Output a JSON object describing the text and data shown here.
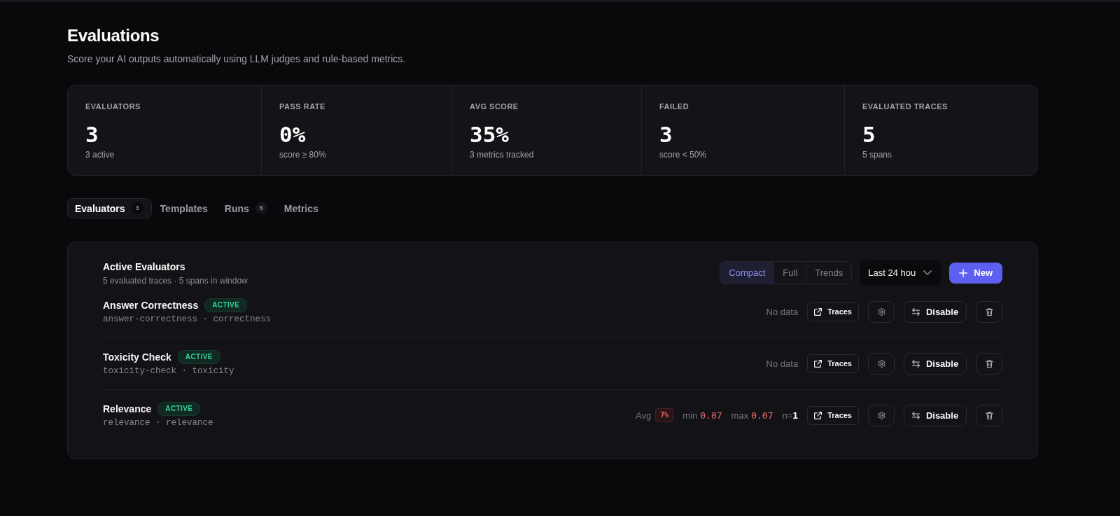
{
  "header": {
    "title": "Evaluations",
    "subtitle": "Score your AI outputs automatically using LLM judges and rule-based metrics."
  },
  "stats": [
    {
      "label": "EVALUATORS",
      "value": "3",
      "sub": "3 active"
    },
    {
      "label": "PASS RATE",
      "value": "0%",
      "sub": "score ≥ 80%"
    },
    {
      "label": "AVG SCORE",
      "value": "35%",
      "sub": "3 metrics tracked"
    },
    {
      "label": "FAILED",
      "value": "3",
      "sub": "score < 50%"
    },
    {
      "label": "EVALUATED TRACES",
      "value": "5",
      "sub": "5 spans"
    }
  ],
  "tabs": [
    {
      "label": "Evaluators",
      "count": "3",
      "selected": true
    },
    {
      "label": "Templates",
      "selected": false
    },
    {
      "label": "Runs",
      "count": "5",
      "selected": false
    },
    {
      "label": "Metrics",
      "selected": false
    }
  ],
  "panel": {
    "title": "Active Evaluators",
    "subtitle": "5 evaluated traces · 5 spans in window",
    "view_modes": [
      {
        "label": "Compact",
        "selected": true
      },
      {
        "label": "Full",
        "selected": false
      },
      {
        "label": "Trends",
        "selected": false
      }
    ],
    "time_range": {
      "value": "Last 24 hou"
    },
    "new_button": {
      "label": "New"
    },
    "evaluators": [
      {
        "name": "Answer Correctness",
        "status": "ACTIVE",
        "slug": "answer-correctness · correctness",
        "summary": {
          "kind": "empty",
          "text": "No data"
        },
        "traces_label": "Traces",
        "disable_label": "Disable"
      },
      {
        "name": "Toxicity Check",
        "status": "ACTIVE",
        "slug": "toxicity-check · toxicity",
        "summary": {
          "kind": "empty",
          "text": "No data"
        },
        "traces_label": "Traces",
        "disable_label": "Disable"
      },
      {
        "name": "Relevance",
        "status": "ACTIVE",
        "slug": "relevance · relevance",
        "summary": {
          "kind": "scores",
          "avg_label": "Avg",
          "avg": "7%",
          "min_label": "min",
          "min": "0.07",
          "max_label": "max",
          "max": "0.07",
          "count": "n=**1**"
        },
        "traces_label": "Traces",
        "disable_label": "Disable"
      }
    ]
  }
}
